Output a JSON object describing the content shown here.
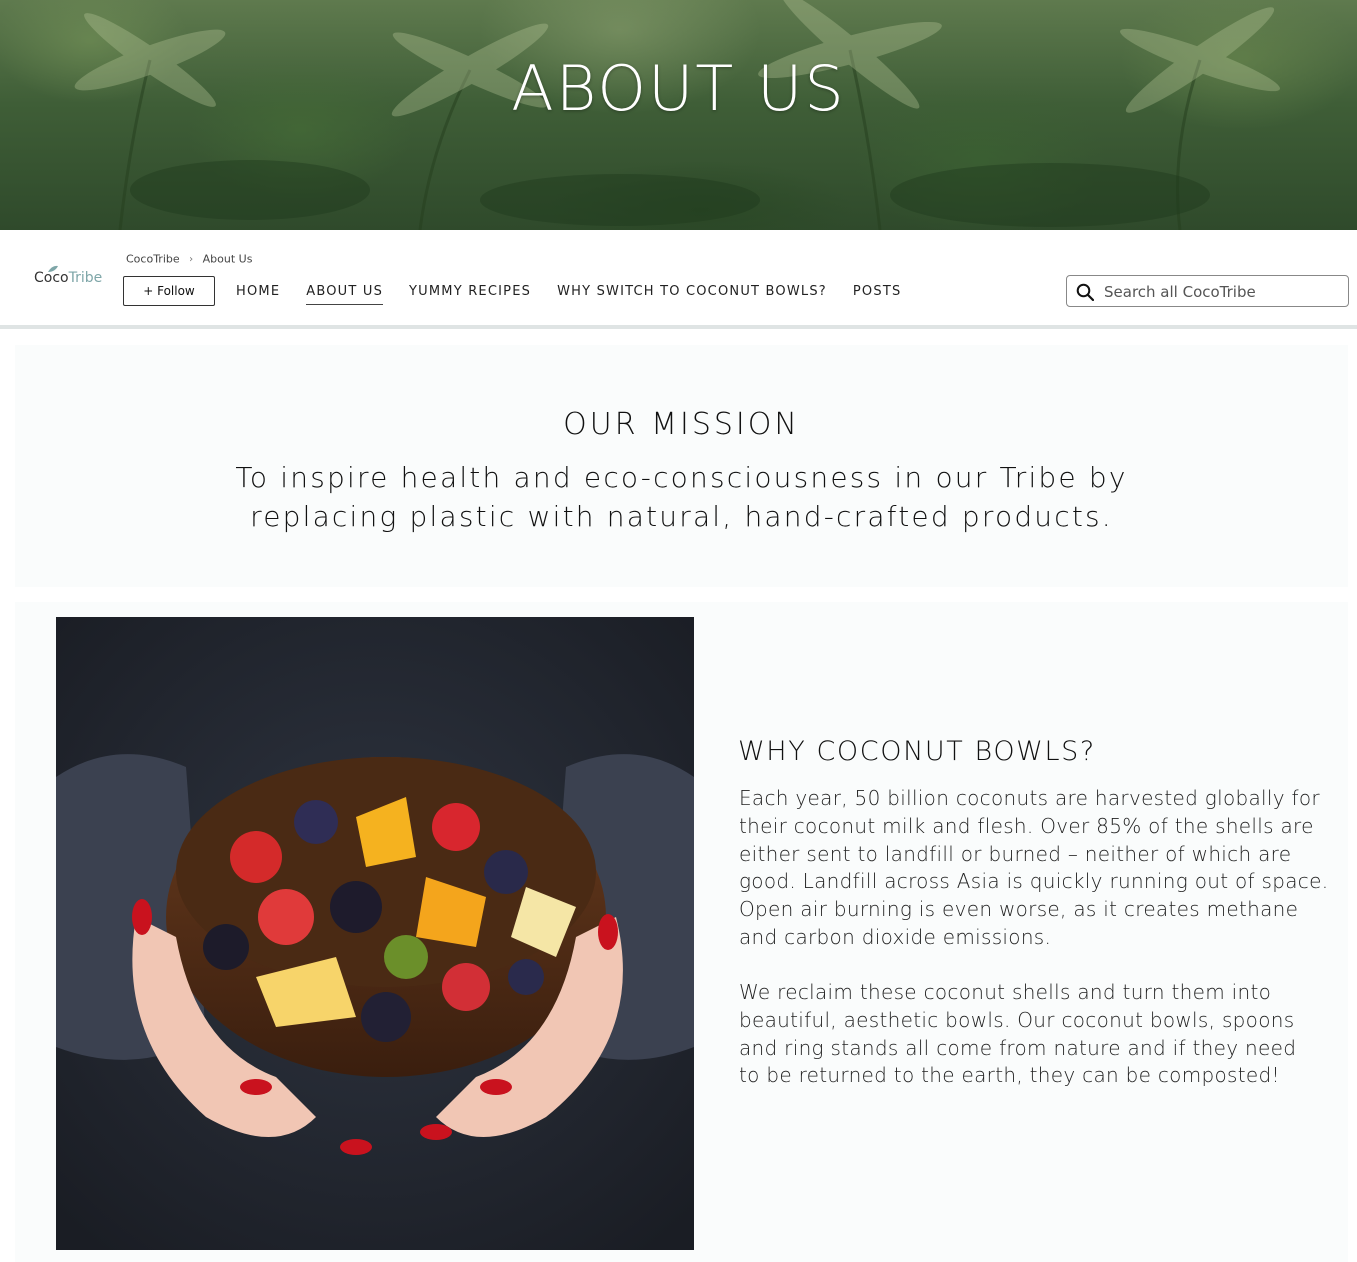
{
  "hero": {
    "title": "ABOUT US"
  },
  "brand": {
    "logo_part1": "Coco",
    "logo_part2": "Tribe"
  },
  "breadcrumb": {
    "home": "CocoTribe",
    "current": "About Us"
  },
  "follow_button": {
    "label": "+ Follow"
  },
  "nav": {
    "items": [
      {
        "label": "HOME",
        "active": false
      },
      {
        "label": "ABOUT US",
        "active": true
      },
      {
        "label": "YUMMY RECIPES",
        "active": false
      },
      {
        "label": "WHY SWITCH TO COCONUT BOWLS?",
        "active": false
      },
      {
        "label": "POSTS",
        "active": false
      }
    ]
  },
  "search": {
    "placeholder": "Search all CocoTribe",
    "icon": "search-icon"
  },
  "mission": {
    "heading": "OUR MISSION",
    "text": "To inspire health and eco-consciousness in our Tribe by replacing plastic with natural, hand-crafted products."
  },
  "why": {
    "heading": "WHY COCONUT BOWLS?",
    "paragraph1": "Each year, 50 billion coconuts are harvested globally for their coconut milk and flesh. Over 85% of the shells are either sent to landfill or burned – neither of which are good. Landfill across Asia is quickly running out of space. Open air burning is even worse, as it creates methane and carbon dioxide emissions.",
    "paragraph2": "We reclaim these coconut shells and turn them into beautiful, aesthetic bowls. Our coconut bowls, spoons and ring stands all come from nature and if they need to be returned to the earth, they can be composted!"
  },
  "colors": {
    "accent": "#7ea6a8",
    "nav_border": "#dfe4e4",
    "section_bg": "#fafcfc"
  }
}
